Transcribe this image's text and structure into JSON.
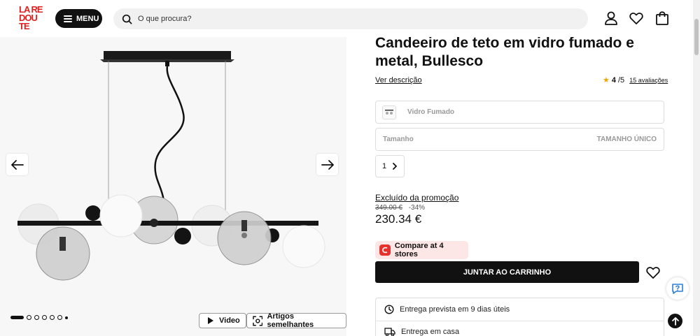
{
  "header": {
    "logo_text": [
      "LA RE",
      "DOU",
      "TE"
    ],
    "menu_label": "MENU",
    "search_placeholder": "O que procura?"
  },
  "gallery": {
    "video_label": "Video",
    "similar_label": "Artigos semelhantes",
    "dots_count": 7,
    "active_index": 0
  },
  "product": {
    "title": "Candeeiro de teto em vidro fumado e metal, Bullesco",
    "description_link": "Ver descrição",
    "rating_score": "4",
    "rating_max": "/5",
    "reviews_link": "15 avaliações",
    "variant_label": "Vidro Fumado",
    "size_label": "Tamanho",
    "size_value": "TAMANHO ÚNICO",
    "quantity": "1",
    "promo_text": "Excluído da promoção",
    "old_price": "349.00 €",
    "discount": "-34%",
    "price": "230.34 €",
    "compare_label": "Compare at 4 stores",
    "cart_label": "JUNTAR AO CARRINHO",
    "delivery_estimate": "Entrega prevista em 9 dias úteis",
    "delivery_home": "Entrega em casa"
  },
  "colors": {
    "brand_red": "#e0201f",
    "primary_dark": "#111111",
    "compare_bg": "#fde6e6",
    "rating_star": "#f0a500"
  }
}
